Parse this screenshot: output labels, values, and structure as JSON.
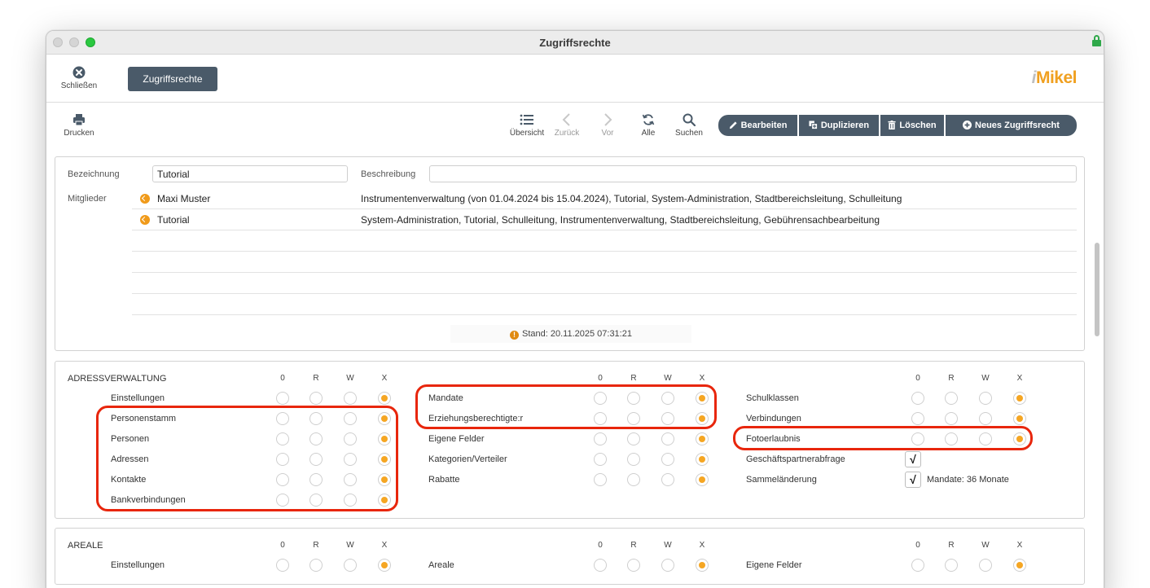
{
  "window": {
    "title": "Zugriffsrechte"
  },
  "topbar": {
    "close_label": "Schließen",
    "tab_label": "Zugriffsrechte",
    "logo_i": "i",
    "logo_text": "Mikel"
  },
  "toolbar": {
    "print_label": "Drucken",
    "overview_label": "Übersicht",
    "back_label": "Zurück",
    "next_label": "Vor",
    "all_label": "Alle",
    "search_label": "Suchen",
    "edit_label": "Bearbeiten",
    "duplicate_label": "Duplizieren",
    "delete_label": "Löschen",
    "new_label": "Neues Zugriffsrecht"
  },
  "form": {
    "bezeichnung_label": "Bezeichnung",
    "bezeichnung_value": "Tutorial",
    "beschreibung_label": "Beschreibung",
    "beschreibung_value": "",
    "mitglieder_label": "Mitglieder",
    "members": [
      {
        "name": "Maxi Muster",
        "roles": "Instrumentenverwaltung (von 01.04.2024 bis 15.04.2024), Tutorial, System-Administration, Stadtbereichsleitung, Schulleitung"
      },
      {
        "name": "Tutorial",
        "roles": "System-Administration, Tutorial, Schulleitung, Instrumentenverwaltung, Stadtbereichsleitung, Gebührensachbearbeitung"
      },
      {
        "name": "",
        "roles": ""
      },
      {
        "name": "",
        "roles": ""
      },
      {
        "name": "",
        "roles": ""
      },
      {
        "name": "",
        "roles": ""
      }
    ],
    "stand": "Stand: 20.11.2025 07:31:21"
  },
  "columns": [
    "0",
    "R",
    "W",
    "X"
  ],
  "adressverwaltung": {
    "title": "ADRESSVERWALTUNG",
    "left": [
      "Einstellungen",
      "Personenstamm",
      "Personen",
      "Adressen",
      "Kontakte",
      "Bankverbindungen"
    ],
    "middle": [
      "Mandate",
      "Erziehungsberechtigte:r",
      "Eigene Felder",
      "Kategorien/Verteiler",
      "Rabatte"
    ],
    "right": [
      "Schulklassen",
      "Verbindungen",
      "Fotoerlaubnis"
    ],
    "checks": [
      {
        "label": "Geschäftspartnerabfrage",
        "mark": "√",
        "note": ""
      },
      {
        "label": "Sammeländerung",
        "mark": "√",
        "note": "Mandate: 36 Monate"
      }
    ],
    "selected_level": "X"
  },
  "areale": {
    "title": "AREALE",
    "left": [
      "Einstellungen"
    ],
    "middle": [
      "Areale"
    ],
    "right": [
      "Eigene Felder"
    ],
    "selected_level": "X"
  },
  "highlight_color": "#e8260c",
  "accent_color": "#f5a623"
}
